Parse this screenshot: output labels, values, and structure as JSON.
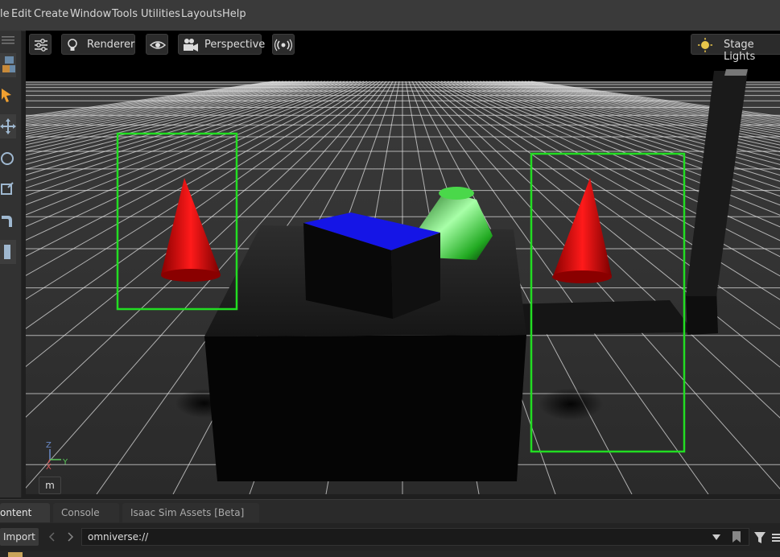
{
  "menu": {
    "items": [
      "le",
      "Edit",
      "Create",
      "Window",
      "Tools",
      "Utilities",
      "Layouts",
      "Help"
    ]
  },
  "viewport": {
    "settings_icon": "sliders-icon",
    "renderer_label": "Renderer",
    "renderer_icon": "lightbulb-icon",
    "visibility_icon": "eye-icon",
    "camera_label": "Perspective",
    "camera_icon": "camera-icon",
    "stream_icon": "broadcast-icon",
    "lights_label": "Stage Lights",
    "lights_icon": "sun-icon",
    "axis_labels": {
      "z": "Z",
      "x": "X",
      "y": "Y"
    },
    "unit_label": "m",
    "colors": {
      "bbox": "#22dd22",
      "cone": "#e00000",
      "cube": "#1010e0",
      "cylinder": "#33ee33",
      "grid": "#e8e8e8"
    }
  },
  "panel": {
    "tabs": [
      "ontent",
      "Console",
      "Isaac Sim Assets [Beta]"
    ],
    "active_tab": "ontent",
    "import_label": "Import",
    "path_value": "omniverse://",
    "back_icon": "chevron-left-icon",
    "forward_icon": "chevron-right-icon",
    "dropdown_icon": "caret-down-icon",
    "bookmark_icon": "bookmark-icon",
    "filter_icon": "filter-icon",
    "menu_icon": "hamburger-icon"
  }
}
